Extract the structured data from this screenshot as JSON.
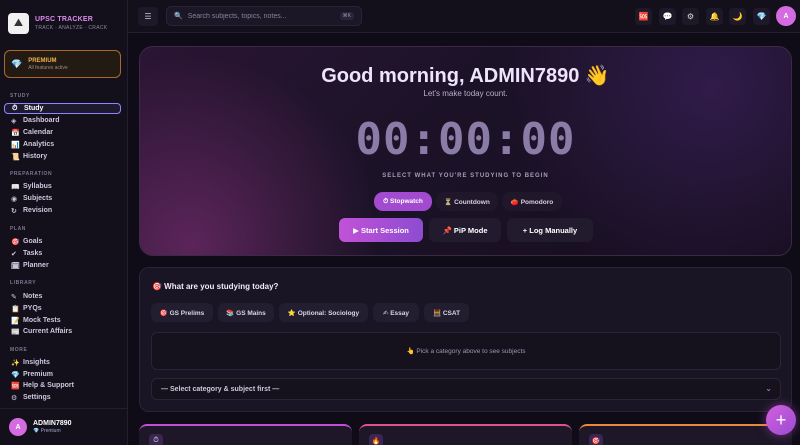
{
  "brand": {
    "title": "UPSC TRACKER",
    "subtitle": "TRACK · ANALYZE · CRACK"
  },
  "premium_card": {
    "title": "PREMIUM",
    "subtitle": "All features active"
  },
  "sidebar": {
    "sections": [
      {
        "label": "STUDY",
        "items": [
          {
            "icon": "⏱",
            "label": "Study",
            "active": true
          },
          {
            "icon": "◈",
            "label": "Dashboard"
          },
          {
            "icon": "📅",
            "label": "Calendar"
          },
          {
            "icon": "📊",
            "label": "Analytics"
          },
          {
            "icon": "📜",
            "label": "History"
          }
        ]
      },
      {
        "label": "PREPARATION",
        "items": [
          {
            "icon": "📖",
            "label": "Syllabus"
          },
          {
            "icon": "◉",
            "label": "Subjects"
          },
          {
            "icon": "↻",
            "label": "Revision"
          }
        ]
      },
      {
        "label": "PLAN",
        "items": [
          {
            "icon": "🎯",
            "label": "Goals"
          },
          {
            "icon": "✔",
            "label": "Tasks"
          },
          {
            "icon": "🗓",
            "label": "Planner"
          }
        ]
      },
      {
        "label": "LIBRARY",
        "items": [
          {
            "icon": "✎",
            "label": "Notes"
          },
          {
            "icon": "📋",
            "label": "PYQs"
          },
          {
            "icon": "📝",
            "label": "Mock Tests"
          },
          {
            "icon": "📰",
            "label": "Current Affairs"
          }
        ]
      },
      {
        "label": "MORE",
        "items": [
          {
            "icon": "✨",
            "label": "Insights"
          },
          {
            "icon": "💎",
            "label": "Premium"
          },
          {
            "icon": "🆘",
            "label": "Help & Support"
          },
          {
            "icon": "⚙",
            "label": "Settings"
          }
        ]
      }
    ]
  },
  "user": {
    "initial": "A",
    "name": "ADMIN7890",
    "tier": "💎 Premium"
  },
  "topbar": {
    "menu_icon": "☰",
    "search_placeholder": "Search subjects, topics, notes...",
    "search_shortcut": "⌘K",
    "icons": [
      "🆘",
      "💬",
      "⚙",
      "🔔",
      "🌙",
      "💎"
    ],
    "avatar_initial": "A"
  },
  "hero": {
    "greeting": "Good morning, ADMIN7890 👋",
    "subtitle": "Let's make today count.",
    "timer": "00:00:00",
    "select_label": "SELECT WHAT YOU'RE STUDYING TO BEGIN",
    "modes": [
      "⏱ Stopwatch",
      "⏳ Countdown",
      "🍅 Pomodoro"
    ],
    "actions": [
      "▶ Start Session",
      "📌 PiP Mode",
      "+ Log Manually"
    ]
  },
  "study_panel": {
    "title": "🎯 What are you studying today?",
    "categories": [
      "🎯 GS Prelims",
      "📚 GS Mains",
      "⭐ Optional: Sociology",
      "✍ Essay",
      "🧮 CSAT"
    ],
    "hint": "👆 Pick a category above to see subjects",
    "select_placeholder": "— Select category & subject first —",
    "select_chevron": "⌄"
  },
  "stat_icons": [
    "⏱",
    "🔥",
    "🎯"
  ],
  "fab": "+"
}
